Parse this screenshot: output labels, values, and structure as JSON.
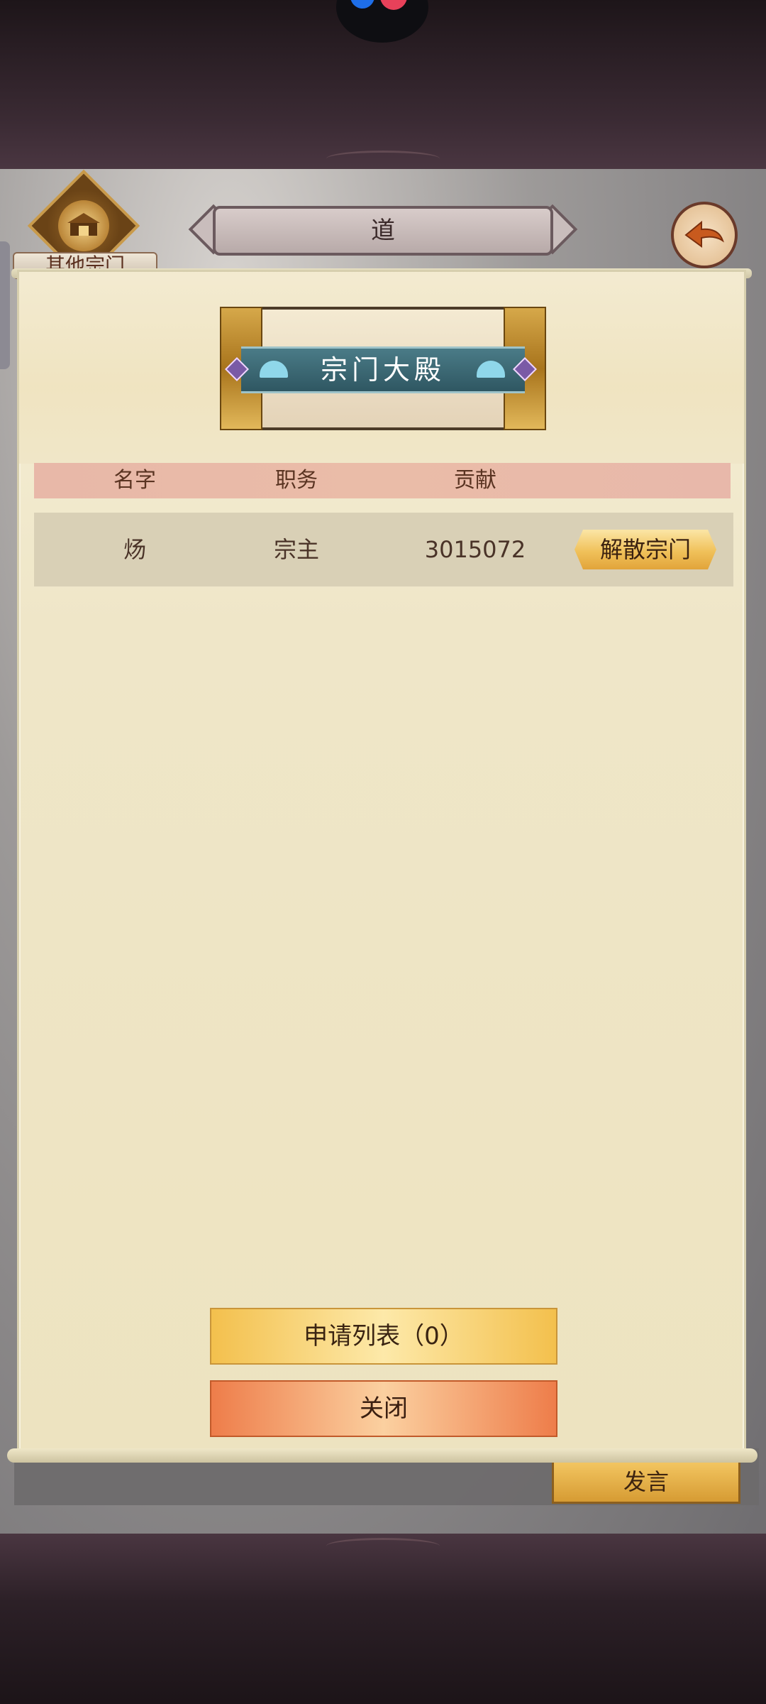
{
  "header": {
    "title": "道",
    "other_sects_label": "其他宗门"
  },
  "panel": {
    "hall_title": "宗门大殿",
    "columns": [
      "名字",
      "职务",
      "贡献"
    ],
    "members": [
      {
        "name": "炀",
        "role": "宗主",
        "contribution": "3015072",
        "action": "解散宗门"
      }
    ],
    "apply_list_label": "申请列表（0）",
    "close_label": "关闭"
  },
  "chat": {
    "speak_label": "发言"
  },
  "colors": {
    "parchment": "#efe6c8",
    "header_bar": "#e8b8a8",
    "banner_teal": "#3d6b77",
    "gold_button": "#f0c15a",
    "orange_button": "#ee7d4a"
  },
  "icons": [
    "sect-emblem-icon",
    "back-arrow-icon",
    "fan-icon",
    "gem-icon",
    "app-logo-icon"
  ]
}
